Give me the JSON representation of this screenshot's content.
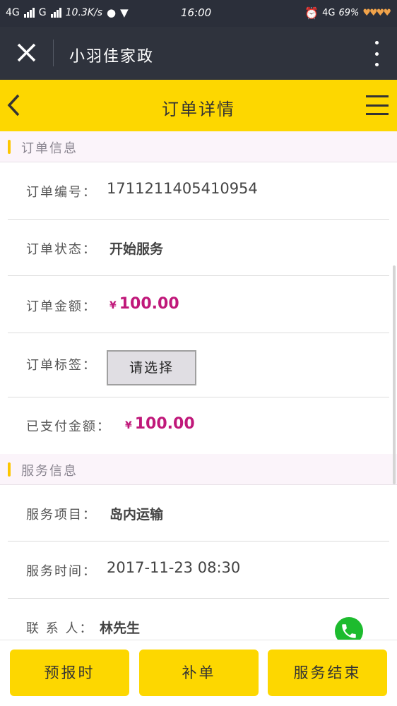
{
  "status_bar": {
    "network_left": "4G",
    "network_left2": "G",
    "speed": "10.3K/s",
    "time": "16:00",
    "network_right": "4G",
    "battery": "69%",
    "icons": [
      "signal-icon",
      "wechat-icon",
      "vpn-shield-icon",
      "alarm-icon",
      "hearts-icon"
    ]
  },
  "title_bar": {
    "close_icon": "close-icon",
    "app_title": "小羽佳家政",
    "more_icon": "more-vertical-icon"
  },
  "nav": {
    "back_icon": "chevron-left-icon",
    "title": "订单详情",
    "menu_icon": "hamburger-menu-icon"
  },
  "order_section": {
    "title": "订单信息",
    "number_label": "订单编号：",
    "number_value": "1711211405410954",
    "status_label": "订单状态：",
    "status_value": "开始服务",
    "amount_label": "订单金额：",
    "amount_currency": "¥",
    "amount_value": "100.00",
    "tag_label": "订单标签：",
    "tag_select": "请选择",
    "paid_label": "已支付金额：",
    "paid_currency": "¥",
    "paid_value": "100.00"
  },
  "service_section": {
    "title": "服务信息",
    "item_label": "服务项目：",
    "item_value": "岛内运输",
    "time_label": "服务时间：",
    "time_value": "2017-11-23 08:30",
    "contact_label": "联 系 人：",
    "contact_value": "林先生",
    "phone_icon": "phone-icon"
  },
  "actions": {
    "report_time": "预报时",
    "supplement": "补单",
    "finish_service": "服务结束"
  },
  "colors": {
    "accent_yellow": "#fdd700",
    "dark_bar": "#2f333d",
    "money": "#c0187a",
    "phone_green": "#1dbb2e"
  }
}
